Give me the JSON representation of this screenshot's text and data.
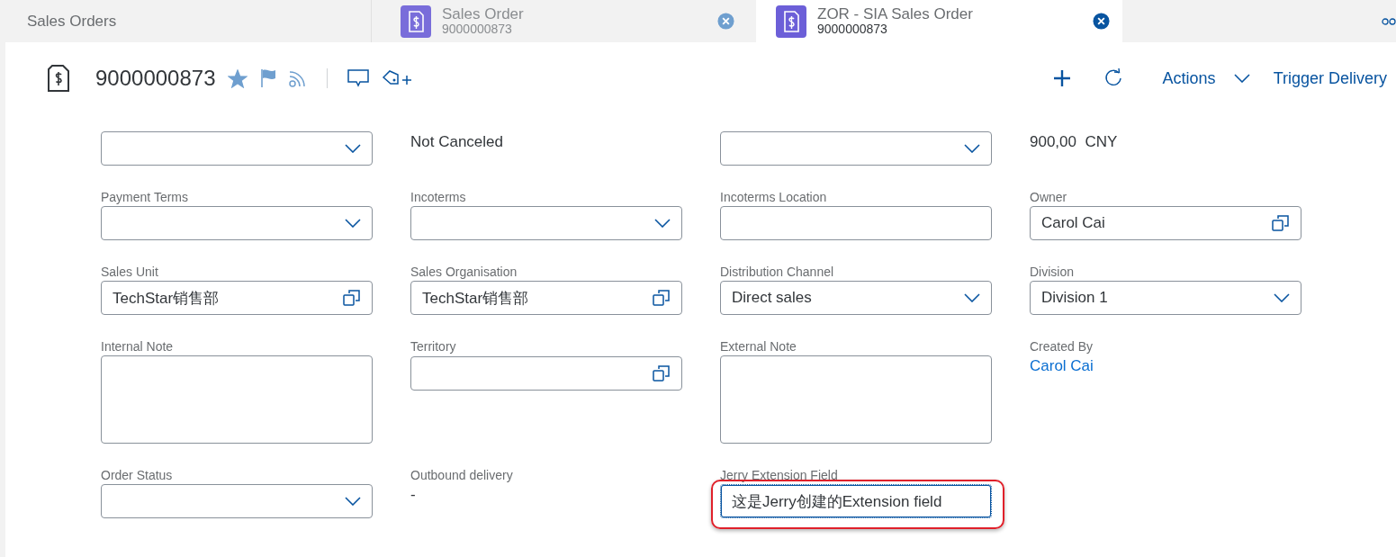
{
  "tabs": [
    {
      "kind": "plain",
      "title": "Sales Orders",
      "selected": false
    },
    {
      "kind": "document",
      "title": "Sales Order",
      "subtitle": "9000000873",
      "selected": false
    },
    {
      "kind": "document",
      "title": "ZOR - SIA Sales Order",
      "subtitle": "9000000873",
      "selected": true
    }
  ],
  "header": {
    "title": "9000000873",
    "favorite": true,
    "actions": [
      {
        "kind": "add"
      },
      {
        "kind": "refresh"
      },
      {
        "kind": "menu",
        "label": "Actions"
      },
      {
        "kind": "button",
        "label": "Trigger Delivery"
      }
    ]
  },
  "form": {
    "rows": [
      [
        {
          "kind": "select"
        },
        {
          "kind": "text",
          "value": "Not Canceled"
        },
        {
          "kind": "select"
        },
        {
          "kind": "text",
          "value": "900,00  CNY"
        }
      ],
      [
        {
          "kind": "select",
          "label": "Payment Terms"
        },
        {
          "kind": "select",
          "label": "Incoterms"
        },
        {
          "kind": "input",
          "label": "Incoterms Location"
        },
        {
          "kind": "value_help",
          "label": "Owner",
          "value": "Carol Cai"
        }
      ],
      [
        {
          "kind": "value_help",
          "label": "Sales Unit",
          "value": "TechStar销售部"
        },
        {
          "kind": "value_help",
          "label": "Sales Organisation",
          "value": "TechStar销售部"
        },
        {
          "kind": "select",
          "label": "Distribution Channel",
          "value": "Direct sales"
        },
        {
          "kind": "select",
          "label": "Division",
          "value": "Division 1"
        }
      ],
      [
        {
          "kind": "textarea",
          "label": "Internal Note"
        },
        {
          "kind": "value_help",
          "label": "Territory"
        },
        {
          "kind": "textarea",
          "label": "External Note"
        },
        {
          "kind": "link",
          "label": "Created By",
          "value": "Carol Cai"
        }
      ],
      [
        {
          "kind": "select",
          "label": "Order Status"
        },
        {
          "kind": "text",
          "label": "Outbound delivery",
          "value": "-"
        },
        {
          "kind": "input",
          "label": "Jerry Extension Field",
          "value": "这是Jerry创建的Extension field",
          "focused": true,
          "highlighted": true
        },
        {
          "kind": "empty"
        }
      ]
    ]
  }
}
